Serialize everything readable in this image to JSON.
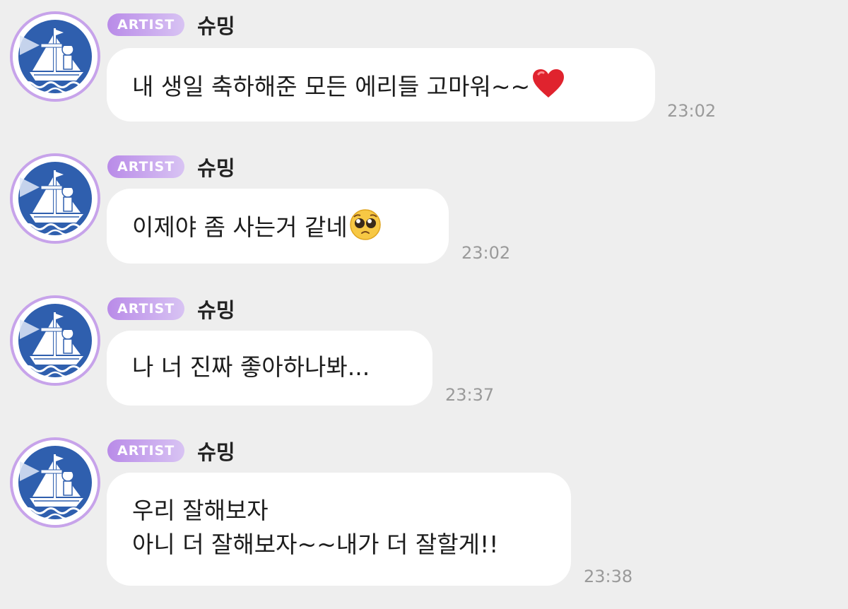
{
  "messages": [
    {
      "badge": "ARTIST",
      "sender": "슈밍",
      "text": "내 생일 축하해준 모든 에리들 고마워~~",
      "emoji": "red-heart-icon",
      "time": "23:02"
    },
    {
      "badge": "ARTIST",
      "sender": "슈밍",
      "text": "이제야 좀 사는거 같네",
      "emoji": "pleading-face-icon",
      "time": "23:02"
    },
    {
      "badge": "ARTIST",
      "sender": "슈밍",
      "text": "나 너 진짜 좋아하나봐...",
      "time": "23:37"
    },
    {
      "badge": "ARTIST",
      "sender": "슈밍",
      "line1": "우리 잘해보자",
      "line2": "아니 더 잘해보자~~내가 더 잘할게!!",
      "time": "23:38"
    }
  ],
  "colors": {
    "background": "#eeeeee",
    "bubble": "#ffffff",
    "badge_start": "#b98be8",
    "badge_end": "#d8c3f3",
    "avatar_ring": "#c7a3ea",
    "avatar_blue": "#2f5fae",
    "time_text": "#9a9a9a"
  }
}
